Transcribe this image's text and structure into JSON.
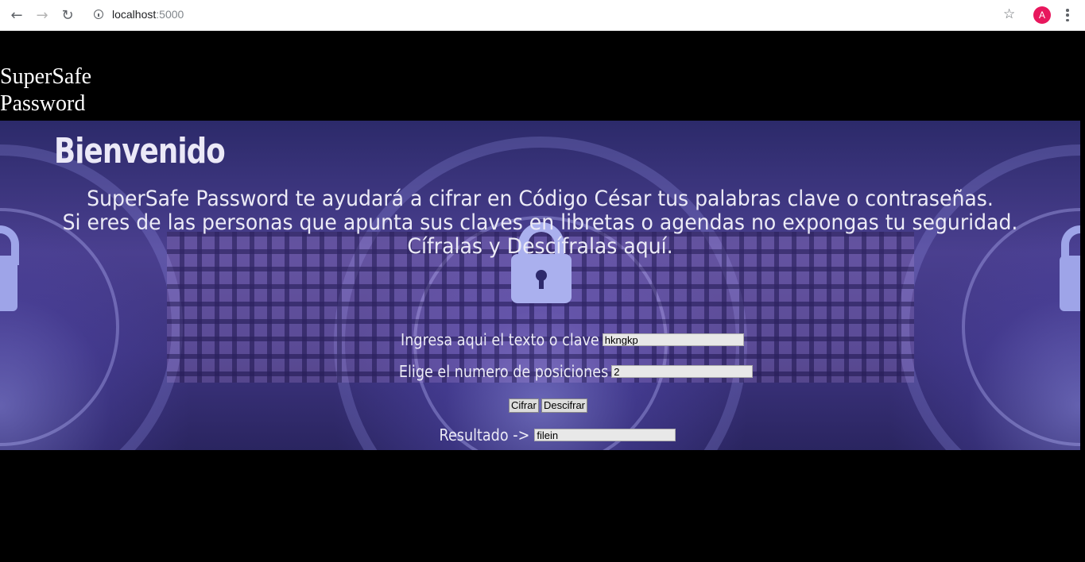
{
  "browser": {
    "url_host": "localhost",
    "url_port": ":5000",
    "avatar_letter": "A",
    "icons": [
      "back-arrow-icon",
      "forward-arrow-icon",
      "reload-icon",
      "info-icon",
      "star-icon",
      "menu-dots-icon"
    ]
  },
  "site": {
    "title_line1": "SuperSafe",
    "title_line2": "Password"
  },
  "hero": {
    "welcome": "Bienvenido",
    "intro_line1": "SuperSafe Password te ayudará a cifrar en Código César tus palabras clave o contraseñas.",
    "intro_line2": "Si eres de las personas que apunta sus claves en libretas o agendas no expongas tu seguridad.",
    "intro_line3": "Cífralas y Descífralas aquí."
  },
  "form": {
    "text_label": "Ingresa aqui el texto o clave",
    "text_value": "hkngkp",
    "positions_label": "Elige el numero de posiciones",
    "positions_value": "2",
    "encrypt_label": "Cifrar",
    "decrypt_label": "Descifrar",
    "result_label": "Resultado ->",
    "result_value": "filein"
  }
}
